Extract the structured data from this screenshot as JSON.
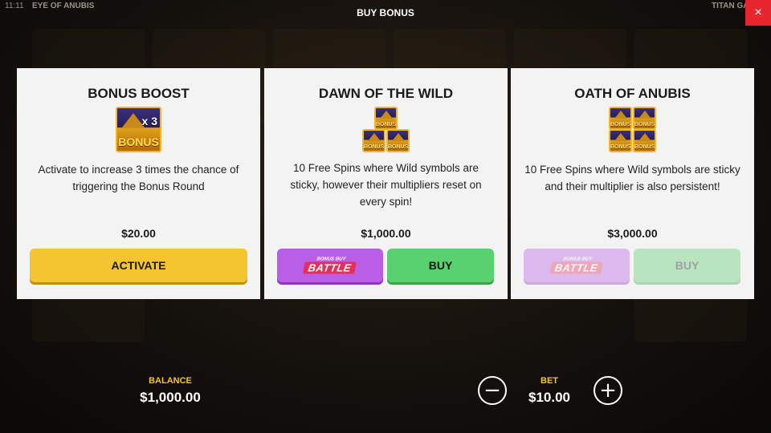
{
  "status": {
    "time": "11:11",
    "game_title": "EYE OF ANUBIS",
    "studio": "TITAN GA"
  },
  "header": {
    "title": "BUY BONUS",
    "close_icon": "×"
  },
  "cards": [
    {
      "title": "BONUS BOOST",
      "icon": "bonus-x3-icon",
      "icon_multiplier": "x 3",
      "icon_label": "BONUS",
      "description": "Activate to increase 3 times the chance of triggering the Bonus Round",
      "price": "$20.00",
      "button_label": "ACTIVATE"
    },
    {
      "title": "DAWN OF THE WILD",
      "icon": "three-bonus-icon",
      "icon_label": "BONUS",
      "description": "10 Free Spins where Wild symbols are sticky, however their multipliers reset on every spin!",
      "price": "$1,000.00",
      "battle_small": "BONUS BUY",
      "battle_large": "BATTLE",
      "button_label": "BUY"
    },
    {
      "title": "OATH OF ANUBIS",
      "icon": "four-bonus-icon",
      "icon_label": "BONUS",
      "description": "10 Free Spins where Wild symbols are sticky and their multiplier is also persistent!",
      "price": "$3,000.00",
      "battle_small": "BONUS BUY",
      "battle_large": "BATTLE",
      "button_label": "BUY",
      "disabled": true
    }
  ],
  "footer": {
    "balance_label": "BALANCE",
    "balance_value": "$1,000.00",
    "bet_label": "BET",
    "bet_value": "$10.00",
    "minus_icon": "−",
    "plus_icon": "+"
  },
  "colors": {
    "accent_yellow": "#f5c431",
    "buy_green": "#58d16e",
    "battle_purple": "#b95ee6",
    "close_red": "#e8262e",
    "card_bg": "#f3f3f3"
  }
}
